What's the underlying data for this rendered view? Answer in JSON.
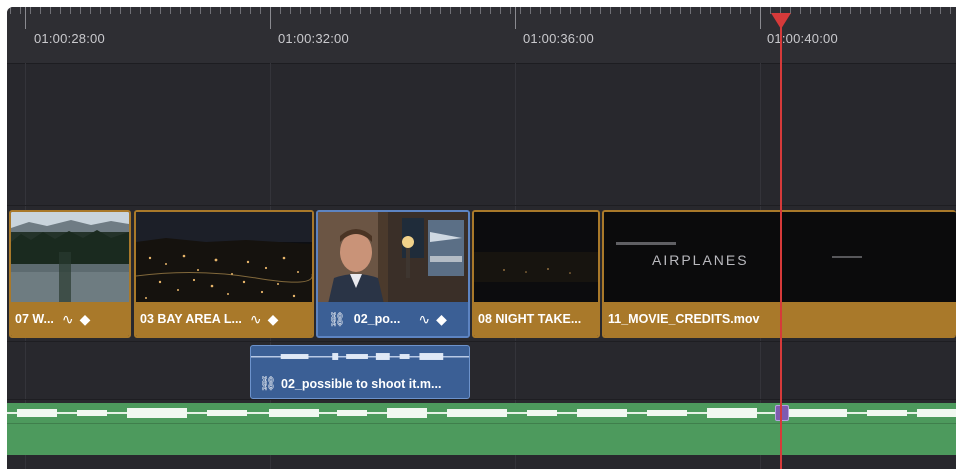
{
  "ruler": {
    "timecodes": [
      "01:00:28:00",
      "01:00:32:00",
      "01:00:36:00",
      "01:00:40:00"
    ]
  },
  "video_clips": [
    {
      "label": "07 W...",
      "icons": [
        "curve-icon",
        "keyframe-icon"
      ],
      "thumb": "forest-lake"
    },
    {
      "label": "03 BAY AREA L...",
      "icons": [
        "curve-icon",
        "keyframe-icon"
      ],
      "thumb": "night-city"
    },
    {
      "label": "02_po...",
      "icons": [
        "link-icon",
        "curve-icon",
        "keyframe-icon"
      ],
      "thumb": "man-interview",
      "selected": true
    },
    {
      "label": "08 NIGHT TAKE...",
      "icons": [],
      "thumb": "dark-night"
    },
    {
      "label": "11_MOVIE_CREDITS.mov",
      "icons": [],
      "thumb": "credits"
    }
  ],
  "credits_title": "AIRPLANES",
  "audio_clip": {
    "label": "02_possible to shoot it.m..."
  },
  "colors": {
    "clip_orange": "#a9792a",
    "clip_selected_blue": "#3b5f95",
    "audio_green": "#4d9a5d",
    "playhead_red": "#d63a3a"
  }
}
